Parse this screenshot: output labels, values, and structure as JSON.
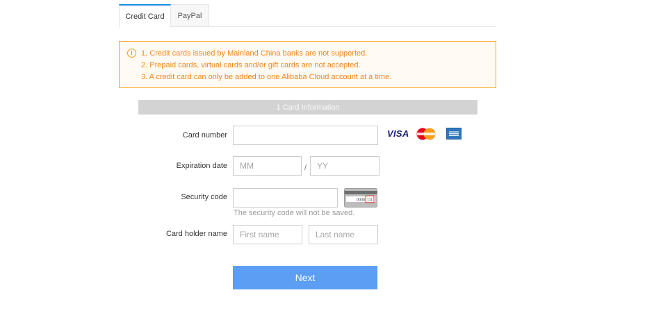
{
  "tabs": [
    {
      "label": "Credit Card",
      "active": true
    },
    {
      "label": "PayPal",
      "active": false
    }
  ],
  "notice": {
    "icon": "info-circle-icon",
    "lines": [
      "1. Credit cards issued by Mainland China banks are not supported.",
      "2. Prepaid cards, virtual cards and/or gift cards are not accepted.",
      "3. A credit card can only be added to one Alibaba Cloud account at a time."
    ],
    "color": "#f0871c"
  },
  "section": {
    "title": "1 Card Information"
  },
  "form": {
    "card_number": {
      "label": "Card number",
      "value": "",
      "placeholder": ""
    },
    "expiration": {
      "label": "Expiration date",
      "month_placeholder": "MM",
      "separator": "/",
      "year_placeholder": "YY"
    },
    "security_code": {
      "label": "Security code",
      "value": "",
      "hint": "The security code will not be saved.",
      "card_digits": "0000",
      "cvv_digits": "111"
    },
    "card_holder": {
      "label": "Card holder name",
      "first_placeholder": "First name",
      "last_placeholder": "Last name"
    }
  },
  "card_logos": {
    "visa": "VISA",
    "mastercard": "mastercard-logo",
    "amex": "amex-logo"
  },
  "next_button": {
    "label": "Next",
    "color": "#5b9ef3"
  }
}
